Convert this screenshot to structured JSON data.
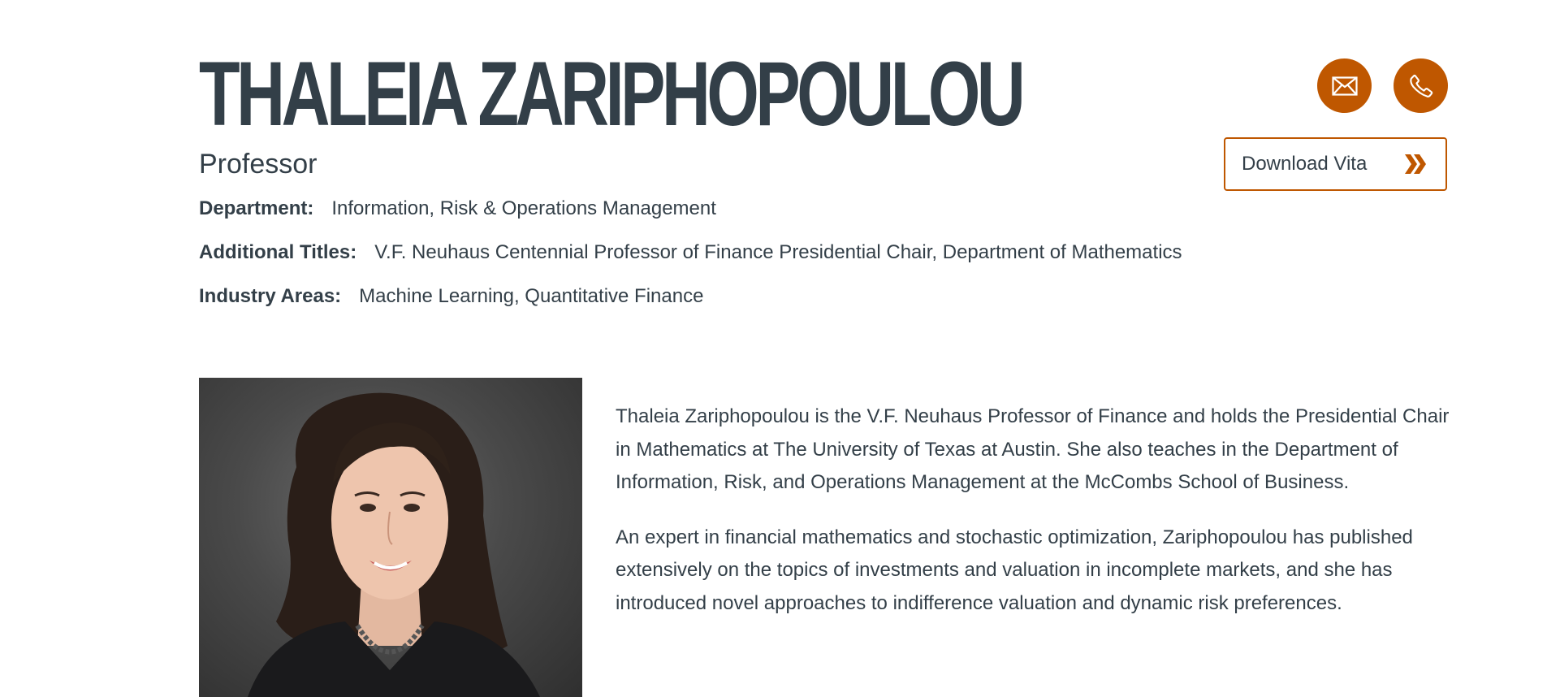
{
  "profile": {
    "name": "THALEIA ZARIPHOPOULOU",
    "title": "Professor",
    "department_label": "Department:",
    "department": "Information, Risk & Operations Management",
    "additional_titles_label": "Additional Titles:",
    "additional_titles": "V.F. Neuhaus Centennial Professor of Finance Presidential Chair, Department of Mathematics",
    "industry_areas_label": "Industry Areas:",
    "industry_areas": "Machine Learning, Quantitative Finance"
  },
  "actions": {
    "email_icon": "envelope-icon",
    "phone_icon": "phone-icon",
    "download_vita_label": "Download Vita",
    "download_icon": "double-chevron-right-icon"
  },
  "bio": {
    "paragraph_1": "Thaleia Zariphopoulou is the V.F. Neuhaus Professor of Finance and holds the Presidential Chair in Mathematics at The University of Texas at Austin. She also teaches in the Department of Information, Risk, and Operations Management at the McCombs School of Business.",
    "paragraph_2": "An expert in financial mathematics and stochastic optimization, Zariphopoulou has published extensively on the topics of investments and valuation in incomplete markets, and she has introduced novel approaches to indifference valuation and dynamic risk preferences."
  },
  "colors": {
    "accent": "#bf5700",
    "text": "#333f48",
    "background": "#ffffff"
  }
}
